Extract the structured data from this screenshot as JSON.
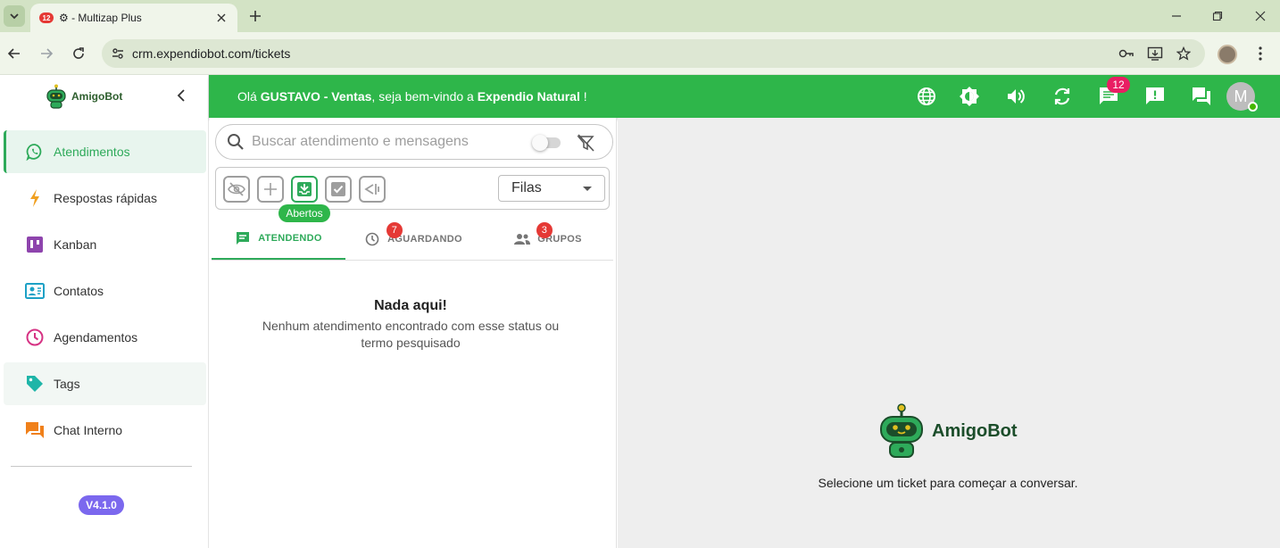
{
  "browser": {
    "tab_badge": "12",
    "tab_title": "⚙ - Multizap Plus",
    "url": "crm.expendiobot.com/tickets"
  },
  "sidebar": {
    "logo_text": "AmigoBot",
    "items": [
      {
        "label": "Atendimentos",
        "icon": "whatsapp-icon",
        "color": "#2eaa5a"
      },
      {
        "label": "Respostas rápidas",
        "icon": "bolt-icon",
        "color": "#f0a020"
      },
      {
        "label": "Kanban",
        "icon": "kanban-icon",
        "color": "#8e44ad"
      },
      {
        "label": "Contatos",
        "icon": "contacts-icon",
        "color": "#1da1c6"
      },
      {
        "label": "Agendamentos",
        "icon": "clock-icon",
        "color": "#d63384"
      },
      {
        "label": "Tags",
        "icon": "tag-icon",
        "color": "#1fb5a8"
      },
      {
        "label": "Chat Interno",
        "icon": "forum-icon",
        "color": "#f0801a"
      }
    ],
    "version": "V4.1.0"
  },
  "header": {
    "greeting_prefix": "Olá ",
    "user": "GUSTAVO - Ventas",
    "greeting_mid": ", seja bem-vindo a ",
    "company": "Expendio Natural",
    "greeting_suffix": " !",
    "notification_count": "12",
    "avatar_initial": "M",
    "bg_color": "#2eb64a"
  },
  "tickets": {
    "search_placeholder": "Buscar atendimento e mensagens",
    "tooltip": "Abertos",
    "queue_select": "Filas",
    "tabs": [
      {
        "label": "ATENDENDO",
        "badge": ""
      },
      {
        "label": "AGUARDANDO",
        "badge": "7"
      },
      {
        "label": "GRUPOS",
        "badge": "3"
      }
    ],
    "empty_title": "Nada aqui!",
    "empty_sub": "Nenhum atendimento encontrado com esse status ou termo pesquisado"
  },
  "chat": {
    "logo_text": "AmigoBot",
    "placeholder": "Selecione um ticket para começar a conversar."
  }
}
